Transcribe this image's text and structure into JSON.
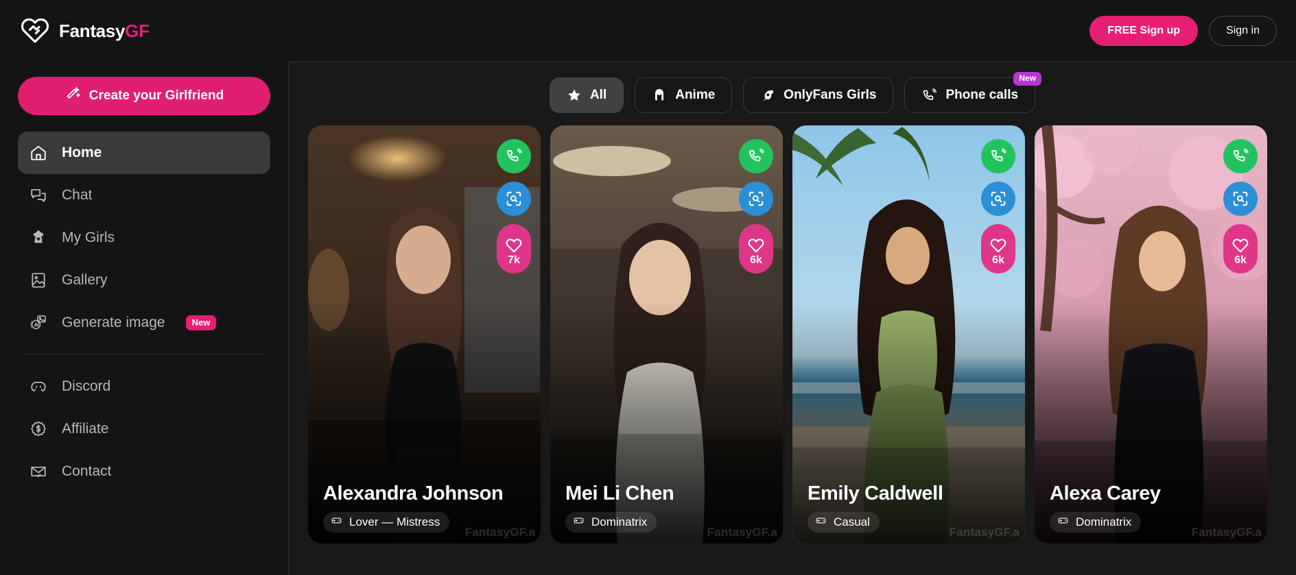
{
  "header": {
    "brand_name": "Fantasy",
    "brand_accent": "GF",
    "brand_icon": "heart-logo-icon",
    "signup_label": "FREE Sign up",
    "signin_label": "Sign in",
    "accent_color": "#e61e74"
  },
  "sidebar": {
    "create_button": {
      "label": "Create your Girlfriend",
      "icon": "magic-wand-icon"
    },
    "items": [
      {
        "label": "Home",
        "icon": "home-icon",
        "active": true
      },
      {
        "label": "Chat",
        "icon": "chat-bubbles-icon",
        "active": false
      },
      {
        "label": "My Girls",
        "icon": "dress-heart-icon",
        "active": false
      },
      {
        "label": "Gallery",
        "icon": "image-icon",
        "active": false
      },
      {
        "label": "Generate image",
        "icon": "ai-image-icon",
        "active": false,
        "badge": "New"
      }
    ],
    "items_secondary": [
      {
        "label": "Discord",
        "icon": "discord-icon"
      },
      {
        "label": "Affiliate",
        "icon": "dollar-badge-icon"
      },
      {
        "label": "Contact",
        "icon": "envelope-check-icon"
      }
    ]
  },
  "filters": [
    {
      "label": "All",
      "icon": "star-icon",
      "active": true
    },
    {
      "label": "Anime",
      "icon": "anime-girl-icon",
      "active": false
    },
    {
      "label": "OnlyFans Girls",
      "icon": "flame-icon",
      "active": false
    },
    {
      "label": "Phone calls",
      "icon": "phone-ring-icon",
      "active": false,
      "badge": "New",
      "badge_color": "#b935d6"
    }
  ],
  "cards": [
    {
      "name": "Alexandra Johnson",
      "tag": "Lover — Mistress",
      "tag_icon": "gamepad-icon",
      "likes": "7k",
      "watermark": "FantasyGF.a",
      "actions": [
        "phone-call-icon",
        "image-scan-icon",
        "heart-icon"
      ]
    },
    {
      "name": "Mei Li Chen",
      "tag": "Dominatrix",
      "tag_icon": "gamepad-icon",
      "likes": "6k",
      "watermark": "FantasyGF.a",
      "actions": [
        "phone-call-icon",
        "image-scan-icon",
        "heart-icon"
      ]
    },
    {
      "name": "Emily Caldwell",
      "tag": "Casual",
      "tag_icon": "gamepad-icon",
      "likes": "6k",
      "watermark": "FantasyGF.a",
      "actions": [
        "phone-call-icon",
        "image-scan-icon",
        "heart-icon"
      ]
    },
    {
      "name": "Alexa Carey",
      "tag": "Dominatrix",
      "tag_icon": "gamepad-icon",
      "likes": "6k",
      "watermark": "FantasyGF.a",
      "actions": [
        "phone-call-icon",
        "image-scan-icon",
        "heart-icon"
      ]
    }
  ]
}
